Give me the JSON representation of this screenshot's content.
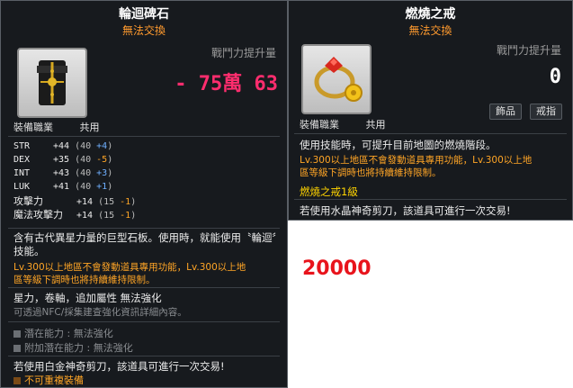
{
  "left": {
    "title": "輪迴碑石",
    "trade": "無法交換",
    "gain_label": "戰鬥力提升量",
    "gain_value": "- 75萬 63",
    "job_label": "裝備職業",
    "job_value": "共用",
    "stats": [
      {
        "name": "STR",
        "total": "+44",
        "paren_open": "(40 ",
        "mod": "+4",
        "paren_close": ")",
        "mod_color": "blue"
      },
      {
        "name": "DEX",
        "total": "+35",
        "paren_open": "(40 ",
        "mod": "-5",
        "paren_close": ")",
        "mod_color": "orange"
      },
      {
        "name": "INT",
        "total": "+43",
        "paren_open": "(40 ",
        "mod": "+3",
        "paren_close": ")",
        "mod_color": "blue"
      },
      {
        "name": "LUK",
        "total": "+41",
        "paren_open": "(40 ",
        "mod": "+1",
        "paren_close": ")",
        "mod_color": "blue"
      },
      {
        "name": "攻擊力",
        "total": "+14",
        "paren_open": "(15 ",
        "mod": "-1",
        "paren_close": ")",
        "mod_color": "orange"
      },
      {
        "name": "魔法攻擊力",
        "total": "+14",
        "paren_open": "(15 ",
        "mod": "-1",
        "paren_close": ")",
        "mod_color": "orange"
      }
    ],
    "desc": "含有古代異星力量的巨型石板。使用時，就能使用〝輪迴〞技能。",
    "warn_lines": [
      "Lv.300以上地區不會發動道具專用功能，Lv.300以上地",
      "區等級下調時也將持續維持限制。"
    ],
    "attrs": "星力，卷軸，追加屬性 無法強化",
    "nfc": "可透過NFC/採集建查強化資訊詳細內容。",
    "potential": "潛在能力 : 無法強化",
    "add_potential": "附加潛在能力 : 無法強化",
    "scissors": "若使用白金神奇剪刀，該道具可進行一次交易!",
    "nodup": "不可重複裝備"
  },
  "right": {
    "title": "燃燒之戒",
    "trade": "無法交換",
    "gain_label": "戰鬥力提升量",
    "gain_value": "0",
    "tags": [
      "飾品",
      "戒指"
    ],
    "job_label": "裝備職業",
    "job_value": "共用",
    "desc": "使用技能時，可提升目前地圖的燃燒階段。",
    "warn_lines": [
      "Lv.300以上地區不會發動道具專用功能，Lv.300以上地",
      "區等級下調時也將持續維持限制。"
    ],
    "level": "燃燒之戒1級",
    "scissors": "若使用水晶神奇剪刀，該道具可進行一次交易!"
  },
  "price": "20000",
  "colors": {
    "bg": "#171a1e",
    "orange": "#ff9a2e",
    "pink": "#ff2d6e",
    "price": "#e8141c"
  }
}
